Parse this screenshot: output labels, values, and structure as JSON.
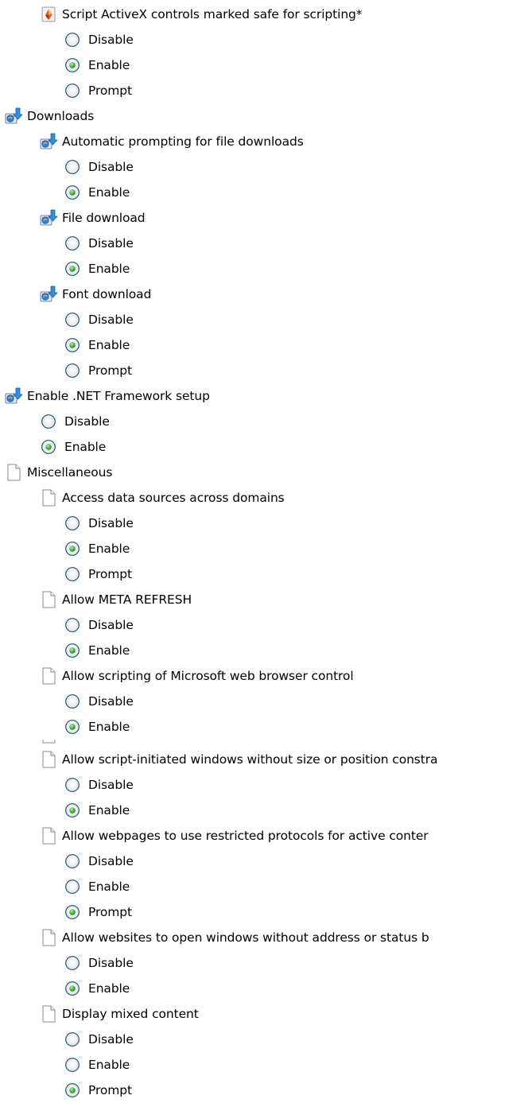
{
  "tree": [
    {
      "kind": "setting",
      "icon": "activex-script-icon",
      "label": "Script ActiveX controls marked safe for scripting*",
      "options": [
        "Disable",
        "Enable",
        "Prompt"
      ],
      "selected": 1
    },
    {
      "kind": "category",
      "icon": "download-icon",
      "label": "Downloads"
    },
    {
      "kind": "setting",
      "icon": "download-icon",
      "label": "Automatic prompting for file downloads",
      "options": [
        "Disable",
        "Enable"
      ],
      "selected": 1
    },
    {
      "kind": "setting",
      "icon": "download-icon",
      "label": "File download",
      "options": [
        "Disable",
        "Enable"
      ],
      "selected": 1
    },
    {
      "kind": "setting",
      "icon": "download-icon",
      "label": "Font download",
      "options": [
        "Disable",
        "Enable",
        "Prompt"
      ],
      "selected": 1
    },
    {
      "kind": "category-setting",
      "icon": "download-icon",
      "label": "Enable .NET Framework setup",
      "options": [
        "Disable",
        "Enable"
      ],
      "selected": 1
    },
    {
      "kind": "category",
      "icon": "document-icon",
      "label": "Miscellaneous"
    },
    {
      "kind": "setting",
      "icon": "document-icon",
      "label": "Access data sources across domains",
      "options": [
        "Disable",
        "Enable",
        "Prompt"
      ],
      "selected": 1
    },
    {
      "kind": "setting",
      "icon": "document-icon",
      "label": "Allow META REFRESH",
      "options": [
        "Disable",
        "Enable"
      ],
      "selected": 1
    },
    {
      "kind": "setting",
      "icon": "document-icon",
      "label": "Allow scripting of Microsoft web browser control",
      "options": [
        "Disable",
        "Enable"
      ],
      "selected": 1
    },
    {
      "kind": "setting",
      "icon": "document-icon",
      "label": "Allow script-initiated windows without size or position constra",
      "options": [
        "Disable",
        "Enable"
      ],
      "selected": 1
    },
    {
      "kind": "setting",
      "icon": "document-icon",
      "label": "Allow webpages to use restricted protocols for active conter",
      "options": [
        "Disable",
        "Enable",
        "Prompt"
      ],
      "selected": 2
    },
    {
      "kind": "setting",
      "icon": "document-icon",
      "label": "Allow websites to open windows without address or status b",
      "options": [
        "Disable",
        "Enable"
      ],
      "selected": 1
    },
    {
      "kind": "setting",
      "icon": "document-icon",
      "label": "Display mixed content",
      "options": [
        "Disable",
        "Enable",
        "Prompt"
      ],
      "selected": 2
    }
  ]
}
